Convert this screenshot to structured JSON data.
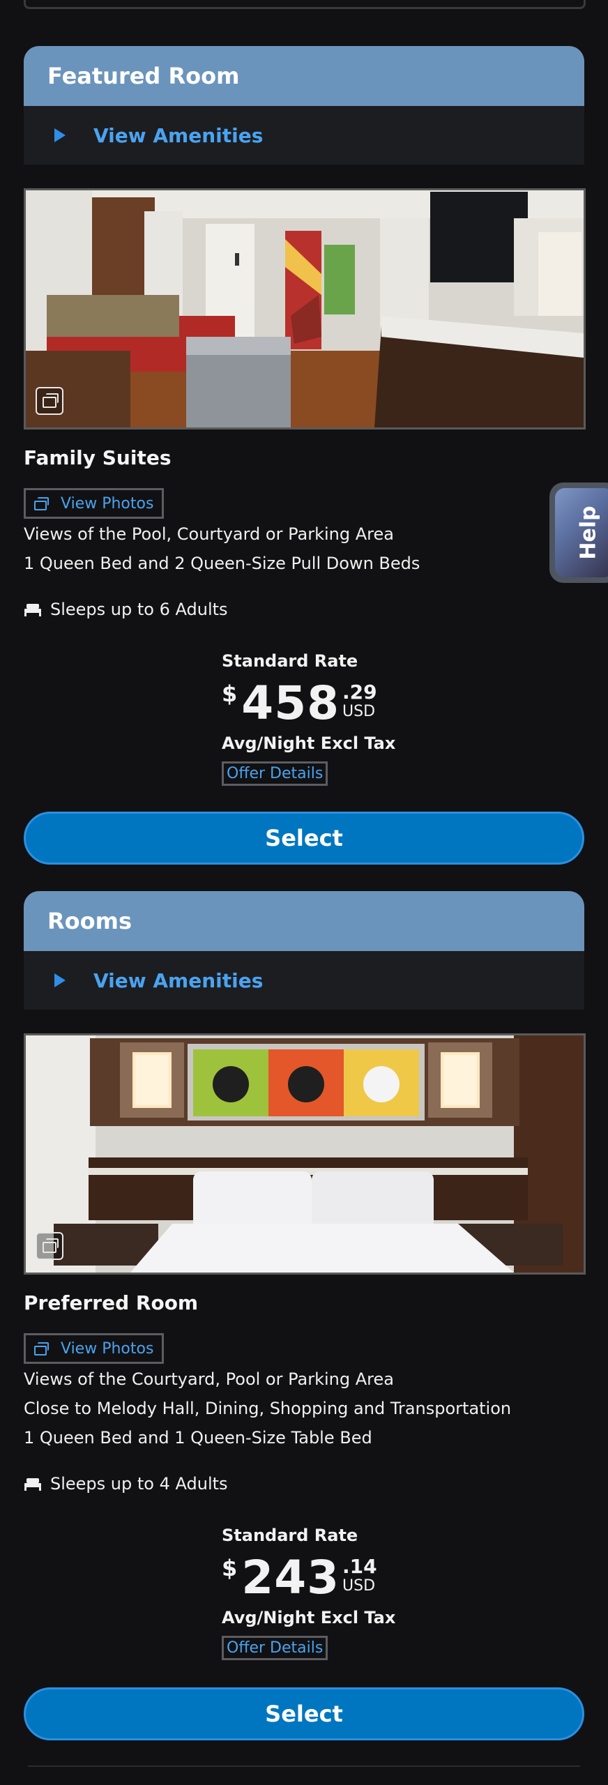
{
  "help": {
    "label": "Help"
  },
  "featured": {
    "header": "Featured Room",
    "amenities_label": "View Amenities",
    "room": {
      "name": "Family Suites",
      "view_photos": "View Photos",
      "description": [
        "Views of the Pool, Courtyard or Parking Area",
        "1 Queen Bed and 2 Queen-Size Pull Down Beds"
      ],
      "sleeps": "Sleeps up to 6 Adults",
      "rate_label": "Standard Rate",
      "currency_symbol": "$",
      "price_dollars": "458",
      "price_cents": ".29",
      "currency_code": "USD",
      "price_note": "Avg/Night Excl Tax",
      "offer_details": "Offer Details",
      "select": "Select"
    }
  },
  "rooms": {
    "header": "Rooms",
    "amenities_label": "View Amenities",
    "room": {
      "name": "Preferred Room",
      "view_photos": "View Photos",
      "description": [
        "Views of the Courtyard, Pool or Parking Area",
        "Close to Melody Hall, Dining, Shopping and Transportation",
        "1 Queen Bed and 1 Queen-Size Table Bed"
      ],
      "sleeps": "Sleeps up to 4 Adults",
      "rate_label": "Standard Rate",
      "currency_symbol": "$",
      "price_dollars": "243",
      "price_cents": ".14",
      "currency_code": "USD",
      "price_note": "Avg/Night Excl Tax",
      "offer_details": "Offer Details",
      "select": "Select"
    }
  },
  "colors": {
    "page_bg": "#111113",
    "header_bg": "#6b94bc",
    "amenities_bg": "#1c1d21",
    "link": "#4aa3f0",
    "primary_button": "#0076c0"
  },
  "icons": [
    "play-triangle-icon",
    "gallery-icon",
    "bed-icon"
  ]
}
